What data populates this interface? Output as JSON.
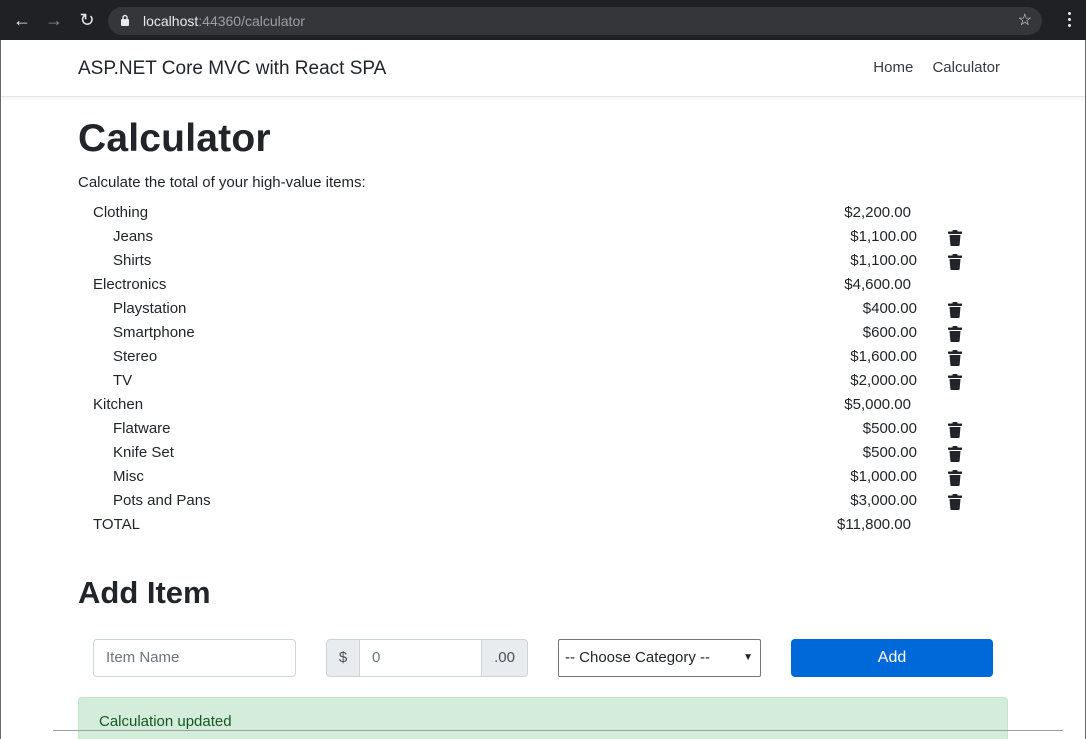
{
  "browser": {
    "url_host": "localhost",
    "url_rest": ":44360/calculator",
    "icons": [
      "back-icon",
      "forward-icon",
      "reload-icon",
      "lock-icon",
      "star-icon",
      "menu-icon"
    ]
  },
  "navbar": {
    "brand": "ASP.NET Core MVC with React SPA",
    "links": [
      "Home",
      "Calculator"
    ]
  },
  "page": {
    "title": "Calculator",
    "subtitle": "Calculate the total of your high-value items:"
  },
  "rows": [
    {
      "name": "Clothing",
      "amount": "$2,200.00"
    },
    {
      "name": "Jeans",
      "amount": "$1,100.00"
    },
    {
      "name": "Shirts",
      "amount": "$1,100.00"
    },
    {
      "name": "Electronics",
      "amount": "$4,600.00"
    },
    {
      "name": "Playstation",
      "amount": "$400.00"
    },
    {
      "name": "Smartphone",
      "amount": "$600.00"
    },
    {
      "name": "Stereo",
      "amount": "$1,600.00"
    },
    {
      "name": "TV",
      "amount": "$2,000.00"
    },
    {
      "name": "Kitchen",
      "amount": "$5,000.00"
    },
    {
      "name": "Flatware",
      "amount": "$500.00"
    },
    {
      "name": "Knife Set",
      "amount": "$500.00"
    },
    {
      "name": "Misc",
      "amount": "$1,000.00"
    },
    {
      "name": "Pots and Pans",
      "amount": "$3,000.00"
    },
    {
      "name": "TOTAL",
      "amount": "$11,800.00"
    }
  ],
  "add_item": {
    "heading": "Add Item",
    "name_placeholder": "Item Name",
    "currency_prefix": "$",
    "value_placeholder": "0",
    "cents_suffix": ".00",
    "category_selected": "-- Choose Category --",
    "add_label": "Add"
  },
  "alert": {
    "message": "Calculation updated"
  },
  "colors": {
    "primary": "#0069d9",
    "alert_bg": "#d4edda",
    "alert_text": "#155724"
  }
}
